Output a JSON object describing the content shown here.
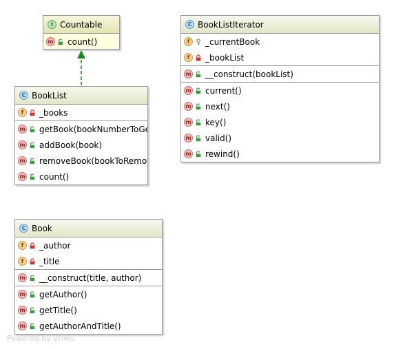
{
  "colors": {
    "method_badge": "#f2b7b3",
    "field_badge": "#f5cd8f",
    "class_badge": "#b8daf2",
    "interface_badge": "#b9e3b5",
    "public_lock": "#3f9a3f",
    "private_lock": "#cc3333",
    "protected_key": "#8d8d8d",
    "arrow": "#1d8a1d",
    "header_gradient_end": "#e3e6c8"
  },
  "nodes": {
    "countable": {
      "kind": "I",
      "name": "Countable",
      "methods": [
        {
          "badge": "m",
          "visibility": "public",
          "label": "count()"
        }
      ]
    },
    "booklist": {
      "kind": "C",
      "name": "BookList",
      "fields": [
        {
          "badge": "f",
          "visibility": "private",
          "label": "_books"
        }
      ],
      "methods": [
        {
          "badge": "m",
          "visibility": "public",
          "label": "getBook(bookNumberToGet)"
        },
        {
          "badge": "m",
          "visibility": "public",
          "label": "addBook(book)"
        },
        {
          "badge": "m",
          "visibility": "public",
          "label": "removeBook(bookToRemove)"
        },
        {
          "badge": "m",
          "visibility": "public",
          "label": "count()"
        }
      ]
    },
    "iterator": {
      "kind": "C",
      "name": "BookListIterator",
      "fields": [
        {
          "badge": "f",
          "visibility": "protected",
          "label": "_currentBook"
        },
        {
          "badge": "f",
          "visibility": "private",
          "label": "_bookList"
        }
      ],
      "constructors": [
        {
          "badge": "m",
          "visibility": "public",
          "label": "__construct(bookList)"
        }
      ],
      "methods": [
        {
          "badge": "m",
          "visibility": "public",
          "label": "current()"
        },
        {
          "badge": "m",
          "visibility": "public",
          "label": "next()"
        },
        {
          "badge": "m",
          "visibility": "public",
          "label": "key()"
        },
        {
          "badge": "m",
          "visibility": "public",
          "label": "valid()"
        },
        {
          "badge": "m",
          "visibility": "public",
          "label": "rewind()"
        }
      ]
    },
    "book": {
      "kind": "C",
      "name": "Book",
      "fields": [
        {
          "badge": "f",
          "visibility": "private",
          "label": "_author"
        },
        {
          "badge": "f",
          "visibility": "private",
          "label": "_title"
        }
      ],
      "constructors": [
        {
          "badge": "m",
          "visibility": "public",
          "label": "__construct(title, author)"
        }
      ],
      "methods": [
        {
          "badge": "m",
          "visibility": "public",
          "label": "getAuthor()"
        },
        {
          "badge": "m",
          "visibility": "public",
          "label": "getTitle()"
        },
        {
          "badge": "m",
          "visibility": "public",
          "label": "getAuthorAndTitle()"
        }
      ]
    }
  },
  "watermark": "Powered by yFiles"
}
